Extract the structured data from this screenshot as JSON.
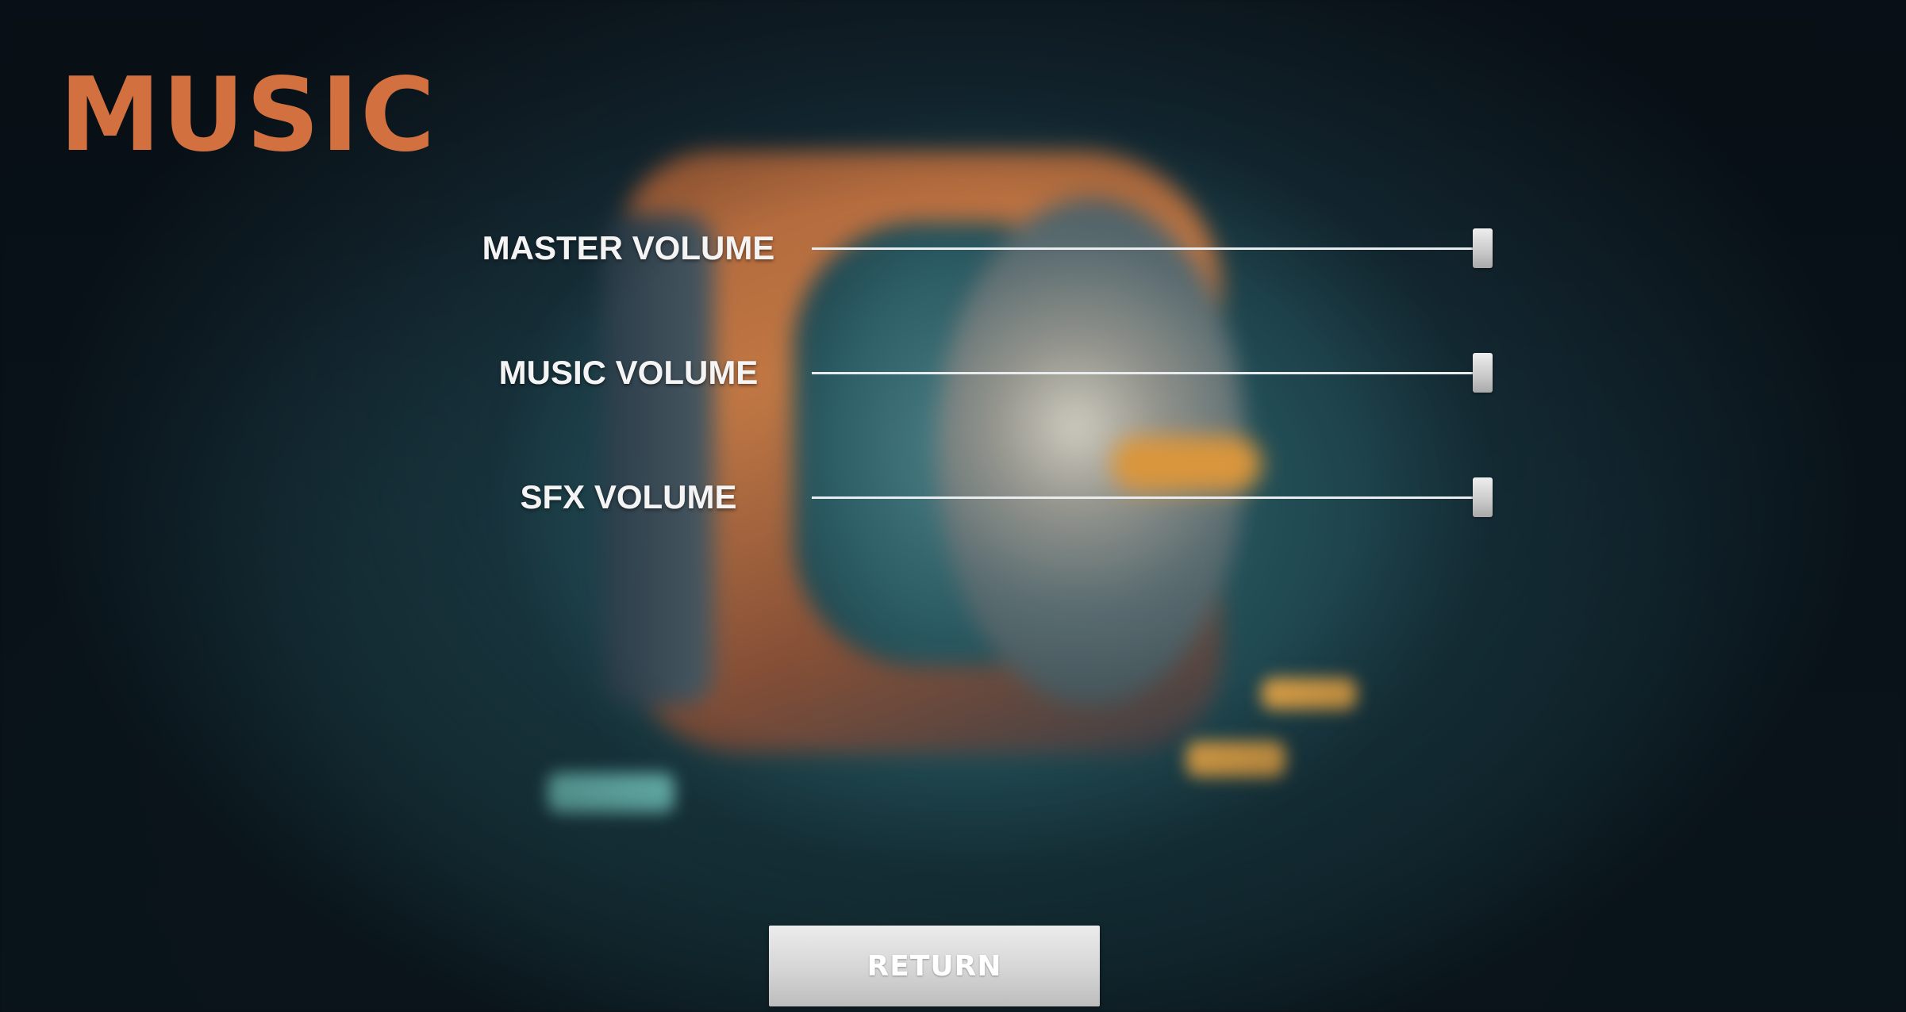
{
  "screen": {
    "title": "MUSIC"
  },
  "sliders": [
    {
      "label": "MASTER VOLUME",
      "level": 1.0
    },
    {
      "label": "MUSIC VOLUME",
      "level": 1.0
    },
    {
      "label": "SFX VOLUME",
      "level": 1.0
    }
  ],
  "buttons": {
    "return_label": "RETURN"
  },
  "colors": {
    "title": "#d3703f",
    "label": "#f4f4f4",
    "track": "#e9ecee",
    "button": "#d5d5d5"
  }
}
